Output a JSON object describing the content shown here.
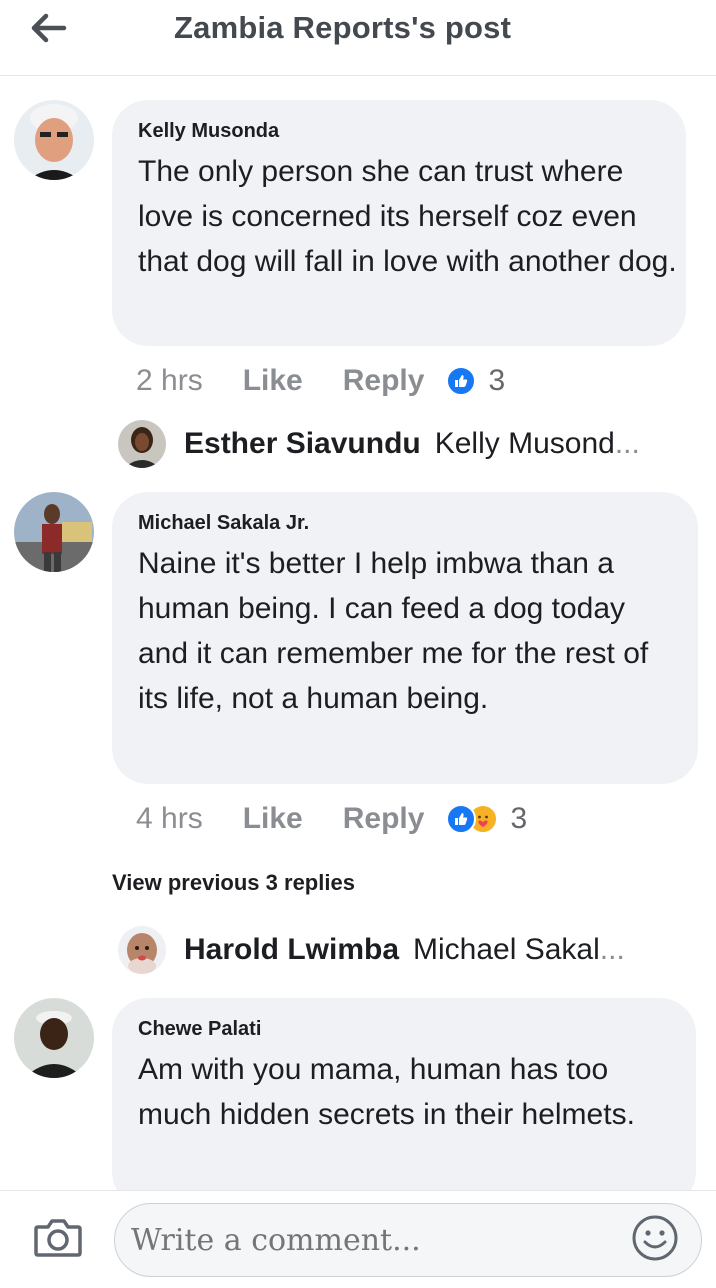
{
  "header": {
    "title": "Zambia Reports's post"
  },
  "comments": [
    {
      "author": "Kelly Musonda",
      "text": "The only person she can trust where love is concerned its herself coz even that dog will fall in love with another dog.",
      "time": "2 hrs",
      "like_label": "Like",
      "reply_label": "Reply",
      "reaction_count": "3",
      "reactions": [
        "like"
      ],
      "reply_preview": {
        "name": "Esther Siavundu",
        "snippet": "Kelly Musond"
      }
    },
    {
      "author": "Michael Sakala Jr.",
      "text": "Naine it's better I help imbwa than a human being. I can feed a dog today and it can remember me for the rest of its life, not a human being.",
      "time": "4 hrs",
      "like_label": "Like",
      "reply_label": "Reply",
      "reaction_count": "3",
      "reactions": [
        "like",
        "care"
      ],
      "view_previous": "View previous 3 replies",
      "reply_preview": {
        "name": "Harold Lwimba",
        "snippet": "Michael Sakal"
      }
    },
    {
      "author": "Chewe Palati",
      "text": "Am with you mama, human has too much hidden secrets in their helmets."
    }
  ],
  "composer": {
    "placeholder": "Write a comment..."
  },
  "colors": {
    "accent": "#1877f2",
    "bubble": "#f0f2f5",
    "muted": "#8a8d91"
  }
}
